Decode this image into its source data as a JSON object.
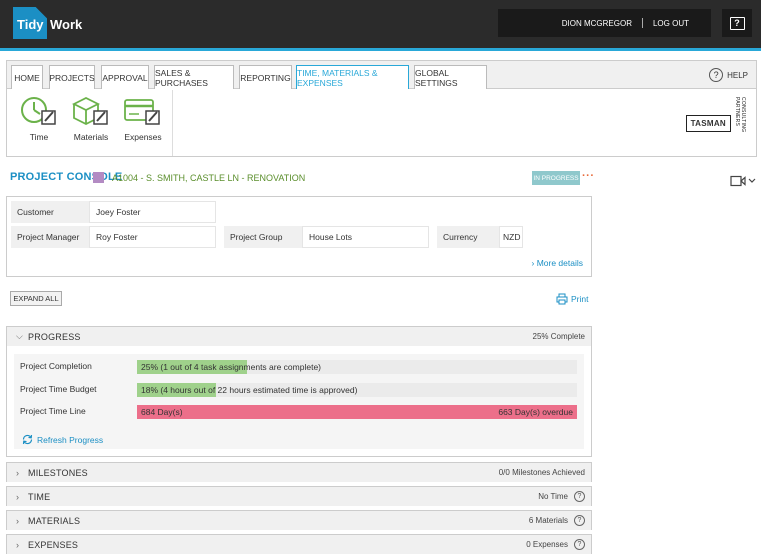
{
  "app": {
    "logo_left": "Tidy",
    "logo_right": "Work",
    "user_name": "DION MCGREGOR",
    "logout_label": "LOG OUT",
    "help_label": "HELP"
  },
  "nav": {
    "tabs": [
      {
        "label": "HOME"
      },
      {
        "label": "PROJECTS"
      },
      {
        "label": "APPROVAL"
      },
      {
        "label": "SALES & PURCHASES"
      },
      {
        "label": "REPORTING"
      },
      {
        "label": "TIME, MATERIALS & EXPENSES",
        "active": true
      },
      {
        "label": "GLOBAL SETTINGS"
      }
    ],
    "tools": [
      {
        "label": "Time",
        "icon": "clock-edit-icon"
      },
      {
        "label": "Materials",
        "icon": "box-edit-icon"
      },
      {
        "label": "Expenses",
        "icon": "card-edit-icon"
      }
    ]
  },
  "company": {
    "name": "TASMAN",
    "sub": "CONSULTING PARTNERS"
  },
  "project": {
    "console_title": "PROJECT CONSOLE",
    "ref": "A1004 - S. SMITH, CASTLE LN - RENOVATION",
    "status": "IN PROGRESS",
    "more": "···",
    "color": "#b38bc3"
  },
  "details": {
    "customer_label": "Customer",
    "customer_value": "Joey Foster",
    "pm_label": "Project Manager",
    "pm_value": "Roy Foster",
    "group_label": "Project Group",
    "group_value": "House Lots",
    "currency_label": "Currency",
    "currency_value": "NZD",
    "more_details": "More details"
  },
  "actions": {
    "expand_all": "EXPAND ALL",
    "print": "Print"
  },
  "progress": {
    "title": "PROGRESS",
    "summary": "25% Complete",
    "rows": [
      {
        "label": "Project Completion",
        "text": "25% (1 out of 4 task assignments are complete)",
        "fraction": 0.25,
        "color": "#9fd18b"
      },
      {
        "label": "Project Time Budget",
        "text": "18% (4 hours out of 22 hours estimated time is approved)",
        "fraction": 0.18,
        "color": "#9fd18b"
      },
      {
        "label": "Project Time Line",
        "text": "684 Day(s)",
        "text_right": "663 Day(s) overdue",
        "fraction": 1.0,
        "color": "#ec6f8a"
      }
    ],
    "refresh": "Refresh Progress"
  },
  "sections": [
    {
      "title": "MILESTONES",
      "right": "0/0 Milestones Achieved",
      "help": false
    },
    {
      "title": "TIME",
      "right": "No Time",
      "help": true
    },
    {
      "title": "MATERIALS",
      "right": "6 Materials",
      "help": true
    },
    {
      "title": "EXPENSES",
      "right": "0 Expenses",
      "help": true
    }
  ],
  "colors": {
    "accent": "#29a8d8",
    "link": "#1b8fc4",
    "ref_green": "#5a8e2b",
    "badge": "#8fc8cc"
  }
}
